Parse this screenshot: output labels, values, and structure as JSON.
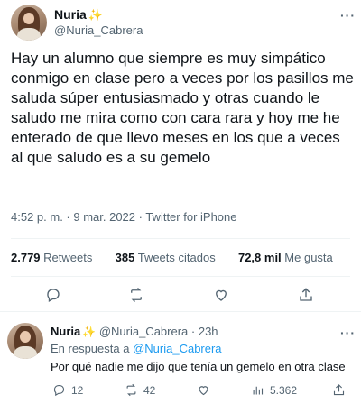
{
  "tweet": {
    "author_name": "Nuria",
    "author_emoji": "✨",
    "author_handle": "@Nuria_Cabrera",
    "more_label": "···",
    "text": "Hay un alumno que siempre es muy simpático conmigo en clase pero a veces por los pasillos me saluda súper entusiasmado y otras cuando le saludo me mira como con cara rara y hoy me he enterado de que llevo meses en los que a veces al que saludo es a su gemelo",
    "timestamp": "4:52 p. m. · 9 mar. 2022 · Twitter for iPhone",
    "stats": {
      "retweets_count": "2.779",
      "retweets_label": "Retweets",
      "quotes_count": "385",
      "quotes_label": "Tweets citados",
      "likes_count": "72,8 mil",
      "likes_label": "Me gusta"
    }
  },
  "reply": {
    "author_name": "Nuria",
    "author_emoji": "✨",
    "author_handle": "@Nuria_Cabrera",
    "time": "· 23h",
    "more_label": "···",
    "in_reply_prefix": "En respuesta a",
    "in_reply_handle": "@Nuria_Cabrera",
    "text": "Por qué nadie me dijo que tenía un gemelo en otra clase",
    "counts": {
      "replies": "12",
      "retweets": "42",
      "likes": "",
      "views": "5.362"
    }
  },
  "icons": {
    "reply": "reply-bubble-icon",
    "retweet": "retweet-icon",
    "like": "heart-icon",
    "share": "share-icon",
    "stats": "bar-chart-icon",
    "verified": "sparkles-emoji"
  },
  "colors": {
    "text": "#0f1419",
    "secondary": "#536471",
    "link": "#1d9bf0",
    "divider": "#eff3f4"
  }
}
